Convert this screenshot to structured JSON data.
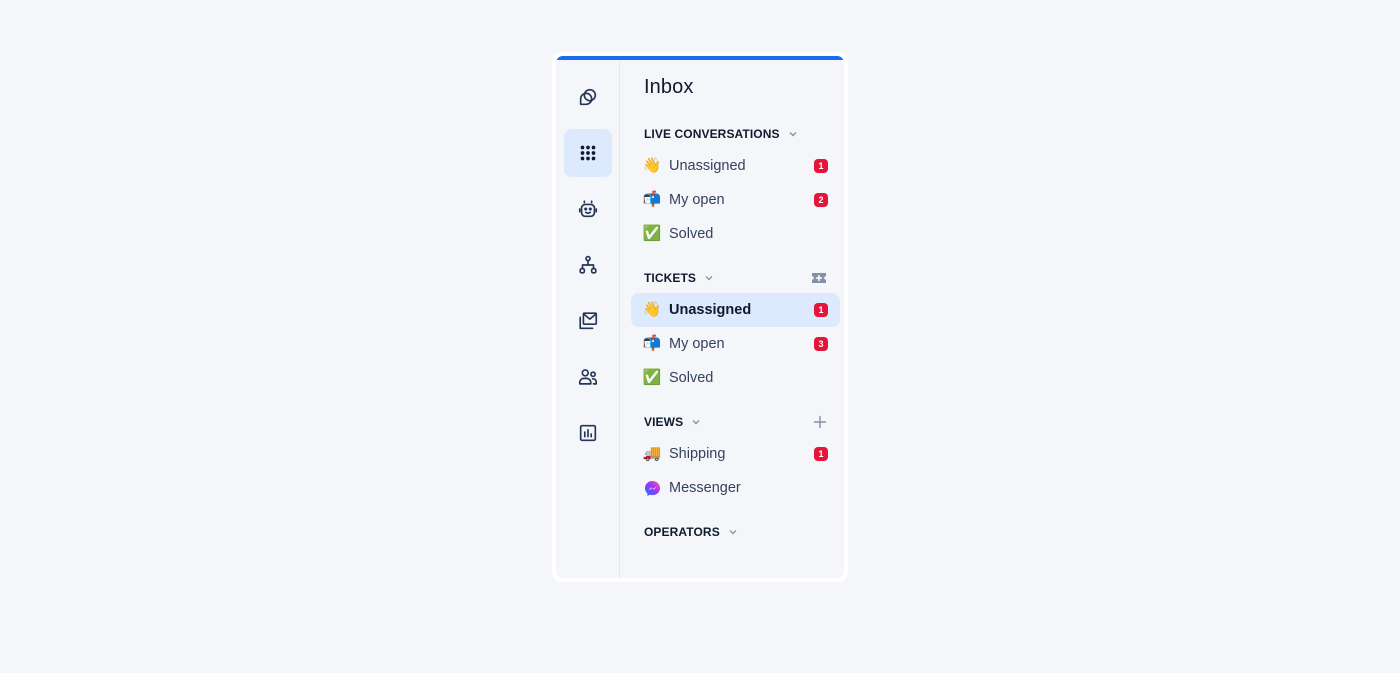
{
  "colors": {
    "accent": "#1a6cf0",
    "badge": "#e2153b",
    "active_bg": "#dde9fc",
    "background": "#f4f6f9"
  },
  "rail": {
    "items": [
      {
        "name": "logo",
        "icon": "overlap-shapes-icon",
        "active": false
      },
      {
        "name": "apps",
        "icon": "grid-dots-icon",
        "active": true
      },
      {
        "name": "bot",
        "icon": "robot-icon",
        "active": false
      },
      {
        "name": "flows",
        "icon": "hierarchy-icon",
        "active": false
      },
      {
        "name": "inbox",
        "icon": "mail-stack-icon",
        "active": false
      },
      {
        "name": "contacts",
        "icon": "users-icon",
        "active": false
      },
      {
        "name": "analytics",
        "icon": "bar-chart-icon",
        "active": false
      }
    ]
  },
  "panel": {
    "title": "Inbox",
    "sections": {
      "live": {
        "title": "LIVE CONVERSATIONS",
        "items": [
          {
            "emoji": "👋",
            "label": "Unassigned",
            "badge": "1"
          },
          {
            "emoji": "📬",
            "label": "My open",
            "badge": "2"
          },
          {
            "emoji": "✅",
            "label": "Solved",
            "badge": null
          }
        ]
      },
      "tickets": {
        "title": "TICKETS",
        "action_icon": "ticket-plus-icon",
        "items": [
          {
            "emoji": "👋",
            "label": "Unassigned",
            "badge": "1",
            "active": true
          },
          {
            "emoji": "📬",
            "label": "My open",
            "badge": "3"
          },
          {
            "emoji": "✅",
            "label": "Solved",
            "badge": null
          }
        ]
      },
      "views": {
        "title": "VIEWS",
        "action_icon": "plus-icon",
        "items": [
          {
            "emoji": "🚚",
            "label": "Shipping",
            "badge": "1"
          },
          {
            "emoji": "messenger",
            "label": "Messenger",
            "badge": null
          }
        ]
      },
      "operators": {
        "title": "OPERATORS"
      }
    }
  }
}
